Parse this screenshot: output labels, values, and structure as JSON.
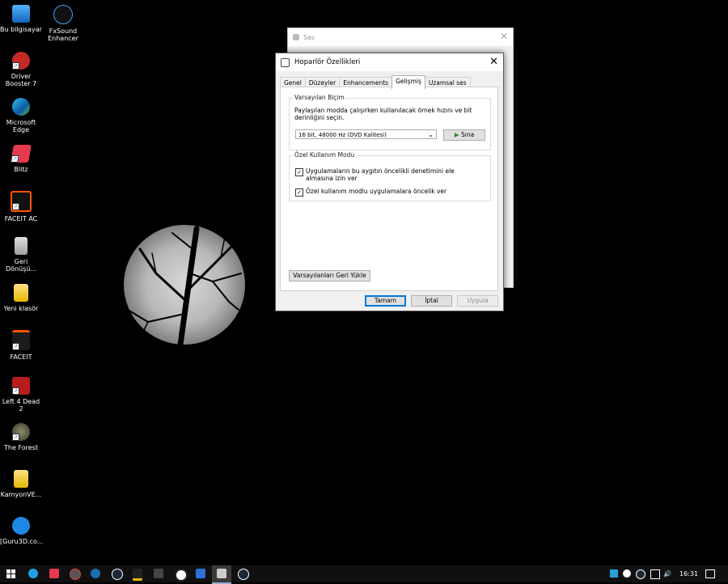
{
  "desktop": {
    "icons": [
      {
        "label": "Bu bilgisayar",
        "icon": "computer-icon"
      },
      {
        "label": "FxSound Enhancer",
        "icon": "fxsound-icon"
      },
      {
        "label": "Driver Booster 7",
        "icon": "driver-booster-icon"
      },
      {
        "label": "Microsoft Edge",
        "icon": "edge-icon"
      },
      {
        "label": "Blitz",
        "icon": "blitz-icon"
      },
      {
        "label": "FACEIT AC",
        "icon": "faceit-ac-icon"
      },
      {
        "label": "Geri Dönüşü...",
        "icon": "recycle-bin-icon"
      },
      {
        "label": "Yeni klasör",
        "icon": "folder-icon"
      },
      {
        "label": "FACEIT",
        "icon": "faceit-icon"
      },
      {
        "label": "Left 4 Dead 2",
        "icon": "left4dead2-icon"
      },
      {
        "label": "The Forest",
        "icon": "the-forest-icon"
      },
      {
        "label": "KamyonVE...",
        "icon": "folder-icon"
      },
      {
        "label": "[Guru3D.co...",
        "icon": "zip-icon"
      }
    ]
  },
  "back_window": {
    "title": "Ses"
  },
  "dialog": {
    "title": "Hoparlör Özellikleri",
    "tabs": [
      {
        "label": "Genel"
      },
      {
        "label": "Düzeyler"
      },
      {
        "label": "Enhancements"
      },
      {
        "label": "Gelişmiş",
        "active": true
      },
      {
        "label": "Uzamsal ses"
      }
    ],
    "default_format": {
      "legend": "Varsayılan Biçim",
      "description": "Paylaşılan modda çalışırken kullanılacak örnek hızını ve bit derinliğini seçin.",
      "selected": "16 bit, 48000 Hz (DVD Kalitesi)",
      "test_button": "Sına"
    },
    "exclusive_mode": {
      "legend": "Özel Kullanım Modu",
      "option1": "Uygulamaların bu aygıtın öncelikli denetimini ele almasına izin ver",
      "option1_checked": true,
      "option2": "Özel kullanım modlu uygulamalara öncelik ver",
      "option2_checked": true
    },
    "restore_button": "Varsayılanları Geri Yükle",
    "ok_button": "Tamam",
    "cancel_button": "İptal",
    "apply_button": "Uygula"
  },
  "taskbar": {
    "time": "16:31",
    "accent_colors": {
      "edge": "#1fa0e6",
      "steam": "#1b2838"
    }
  }
}
